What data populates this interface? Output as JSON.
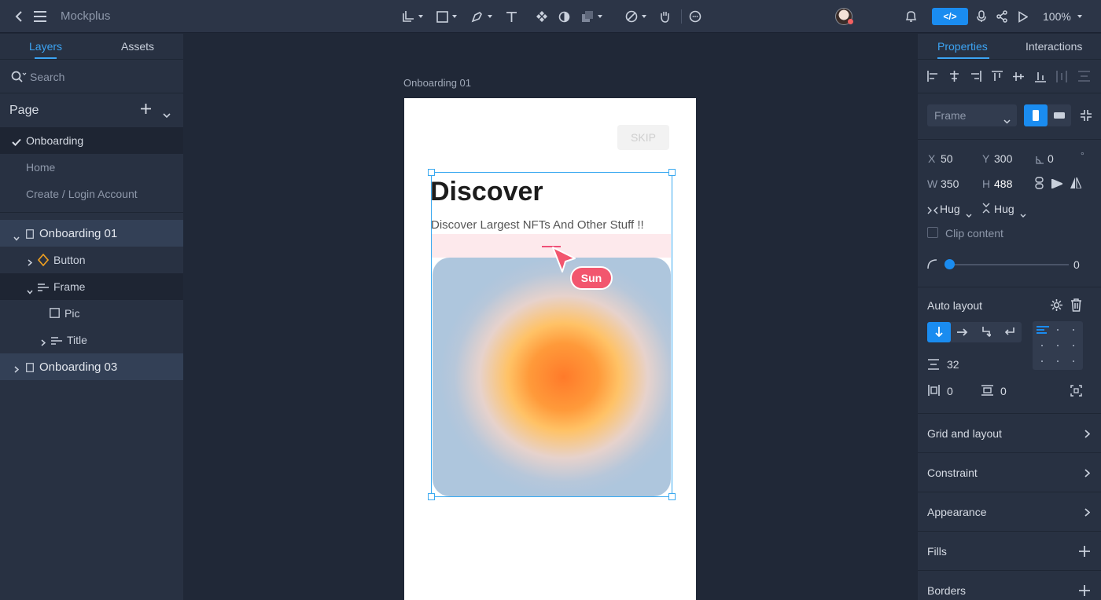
{
  "app": {
    "title": "Mockplus",
    "zoom": "100%"
  },
  "left_panel": {
    "tabs": [
      "Layers",
      "Assets"
    ],
    "search_placeholder": "Search",
    "page_label": "Page",
    "pages": [
      "Onboarding",
      "Home",
      "Create / Login Account"
    ],
    "layers": [
      "Onboarding 01",
      "Button",
      "Frame",
      "Pic",
      "Title",
      "Onboarding 03"
    ]
  },
  "canvas": {
    "artboard_label": "Onboarding  01",
    "skip_label": "SKIP",
    "title": "Discover",
    "subtitle": "Discover Largest NFTs And Other Stuff !!",
    "cursor_tag": "Sun"
  },
  "right_panel": {
    "tabs": [
      "Properties",
      "Interactions"
    ],
    "frame_select": "Frame",
    "x_label": "X",
    "x_value": "50",
    "y_label": "Y",
    "y_value": "300",
    "rot_value": "0",
    "deg": "°",
    "w_label": "W",
    "w_value": "350",
    "h_label": "H",
    "h_value": "488",
    "hug_w": "Hug",
    "hug_h": "Hug",
    "clip_content": "Clip content",
    "radius_value": "0",
    "auto_layout": "Auto layout",
    "spacing_value": "32",
    "pad_h": "0",
    "pad_v": "0",
    "sections": [
      "Grid and layout",
      "Constraint",
      "Appearance",
      "Fills",
      "Borders"
    ]
  },
  "colors": {
    "accent": "#1a8cf0",
    "selection": "#3aa9f0",
    "tag": "#f2566e"
  }
}
